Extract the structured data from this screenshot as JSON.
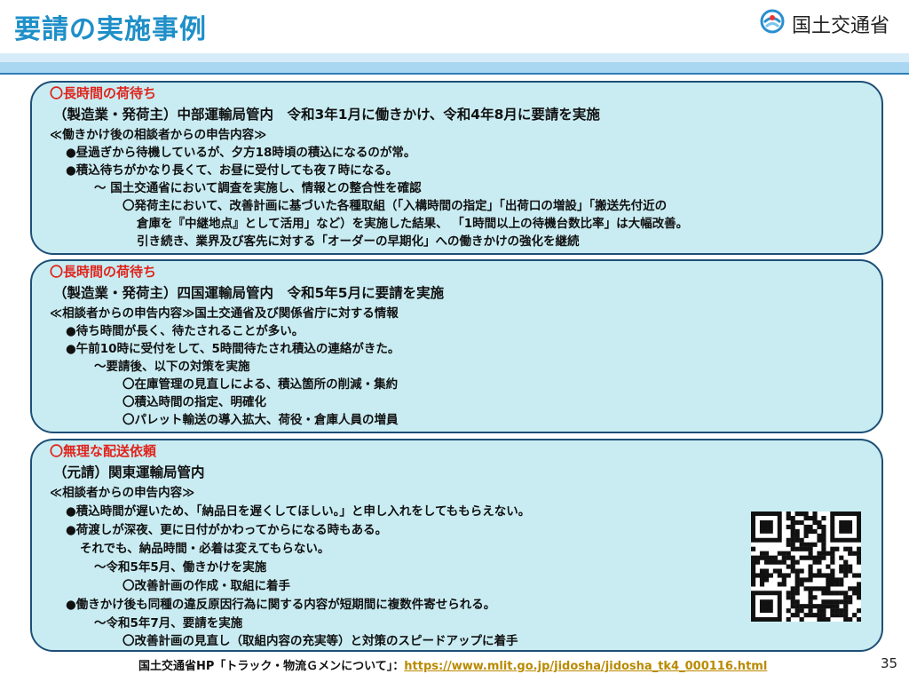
{
  "header": {
    "title": "要請の実施事例",
    "logo_text": "国土交通省",
    "logo_icon": "mlit-logo"
  },
  "cards": [
    {
      "heading": "〇長時間の荷待ち",
      "subheading": "（製造業・発荷主）中部運輸局管内　令和3年1月に働きかけ、令和4年8月に要請を実施",
      "lines": [
        "≪働きかけ後の相談者からの申告内容≫",
        "●昼過ぎから待機しているが、夕方18時頃の積込になるのが常。",
        "●積込待ちがかなり長くて、お昼に受付しても夜７時になる。",
        "～ 国土交通省において調査を実施し、情報との整合性を確認",
        "〇発荷主において、改善計画に基づいた各種取組（「入構時間の指定」「出荷口の増設」「搬送先付近の",
        "倉庫を『中継地点』として活用」など）を実施した結果、 「1時間以上の待機台数比率」は大幅改善。",
        "引き続き、業界及び客先に対する「オーダーの早期化」への働きかけの強化を継続"
      ]
    },
    {
      "heading": "〇長時間の荷待ち",
      "subheading": "（製造業・発荷主）四国運輸局管内　令和5年5月に要請を実施",
      "lines": [
        "≪相談者からの申告内容≫国土交通省及び関係省庁に対する情報",
        "●待ち時間が長く、待たされることが多い。",
        "●午前10時に受付をして、5時間待たされ積込の連絡がきた。",
        "～要請後、以下の対策を実施",
        "〇在庫管理の見直しによる、積込箇所の削減・集約",
        "〇積込時間の指定、明確化",
        "〇パレット輸送の導入拡大、荷役・倉庫人員の増員"
      ]
    },
    {
      "heading": "〇無理な配送依頼",
      "subheading": "（元請）関東運輸局管内",
      "lines": [
        "≪相談者からの申告内容≫",
        "●積込時間が遅いため、「納品日を遅くしてほしい。」と申し入れをしてももらえない。",
        "●荷渡しが深夜、更に日付がかわってからになる時もある。",
        "それでも、納品時間・必着は変えてもらない。",
        "～令和5年5月、働きかけを実施",
        "〇改善計画の作成・取組に着手",
        "●働きかけ後も同種の違反原因行為に関する内容が短期間に複数件寄せられる。",
        "～令和5年7月、要請を実施",
        "〇改善計画の見直し（取組内容の充実等）と対策のスピードアップに着手"
      ]
    }
  ],
  "qr": {
    "icon": "qr-code-icon"
  },
  "footer": {
    "prefix": "国土交通省HP「トラック・物流Ｇメンについて」：",
    "url": "https://www.mlit.go.jp/jidosha/jidosha_tk4_000116.html"
  },
  "page_number": "35",
  "colors": {
    "title": "#1f8fc8",
    "heading_red": "#e0241c",
    "card_bg": "#c9ecf2",
    "card_border": "#1d4f77",
    "link": "#b98a00"
  }
}
